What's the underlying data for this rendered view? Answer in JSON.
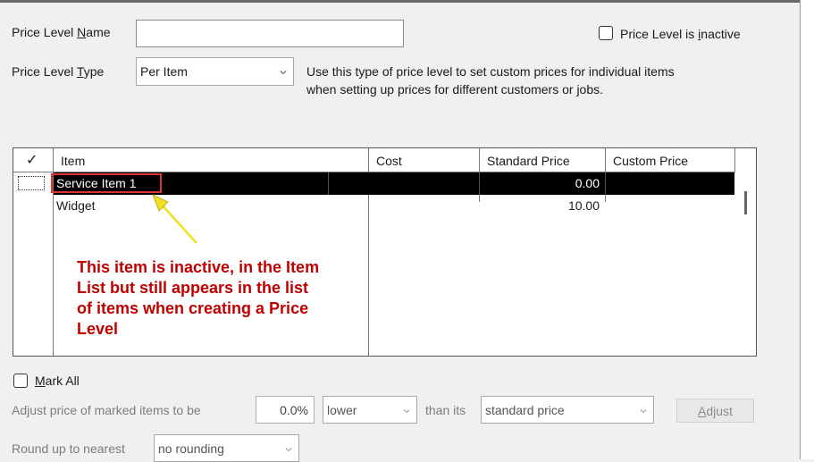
{
  "form": {
    "price_level_name": {
      "label_pre": "Price Level ",
      "label_key": "N",
      "label_post": "ame",
      "value": ""
    },
    "inactive_checkbox": {
      "label_pre": "Price Level is ",
      "label_key": "i",
      "label_post": "nactive",
      "checked": false
    },
    "price_level_type": {
      "label_pre": "Price Level ",
      "label_key": "T",
      "label_post": "ype",
      "value": "Per Item"
    },
    "type_description_line1": "Use this type of price level to set custom prices for individual items",
    "type_description_line2": "when setting up prices for different customers or jobs."
  },
  "table": {
    "check_header": "✓",
    "columns": [
      "Item",
      "Cost",
      "Standard Price",
      "Custom Price"
    ],
    "rows": [
      {
        "item": "Service Item 1",
        "cost": "",
        "standard_price": "0.00",
        "custom_price": "",
        "selected": true
      },
      {
        "item": "Widget",
        "cost": "",
        "standard_price": "10.00",
        "custom_price": "",
        "selected": false
      }
    ]
  },
  "annotation": {
    "line1": "This item is inactive, in the Item",
    "line2": "List but still appears in the list",
    "line3": "of items when creating a Price",
    "line4": "Level",
    "text_color": "#c00000",
    "highlight_color": "#e03030",
    "arrow_color": "#f0e020"
  },
  "mark_all": {
    "label_key": "M",
    "label_post": "ark All",
    "checked": false
  },
  "adjust": {
    "label": "Adjust price of marked items to be",
    "percent": "0.0%",
    "direction": "lower",
    "than_its": "than its",
    "basis": "standard price",
    "button_key": "A",
    "button_post": "djust"
  },
  "round": {
    "label": "Round up to nearest",
    "value": "no rounding"
  }
}
